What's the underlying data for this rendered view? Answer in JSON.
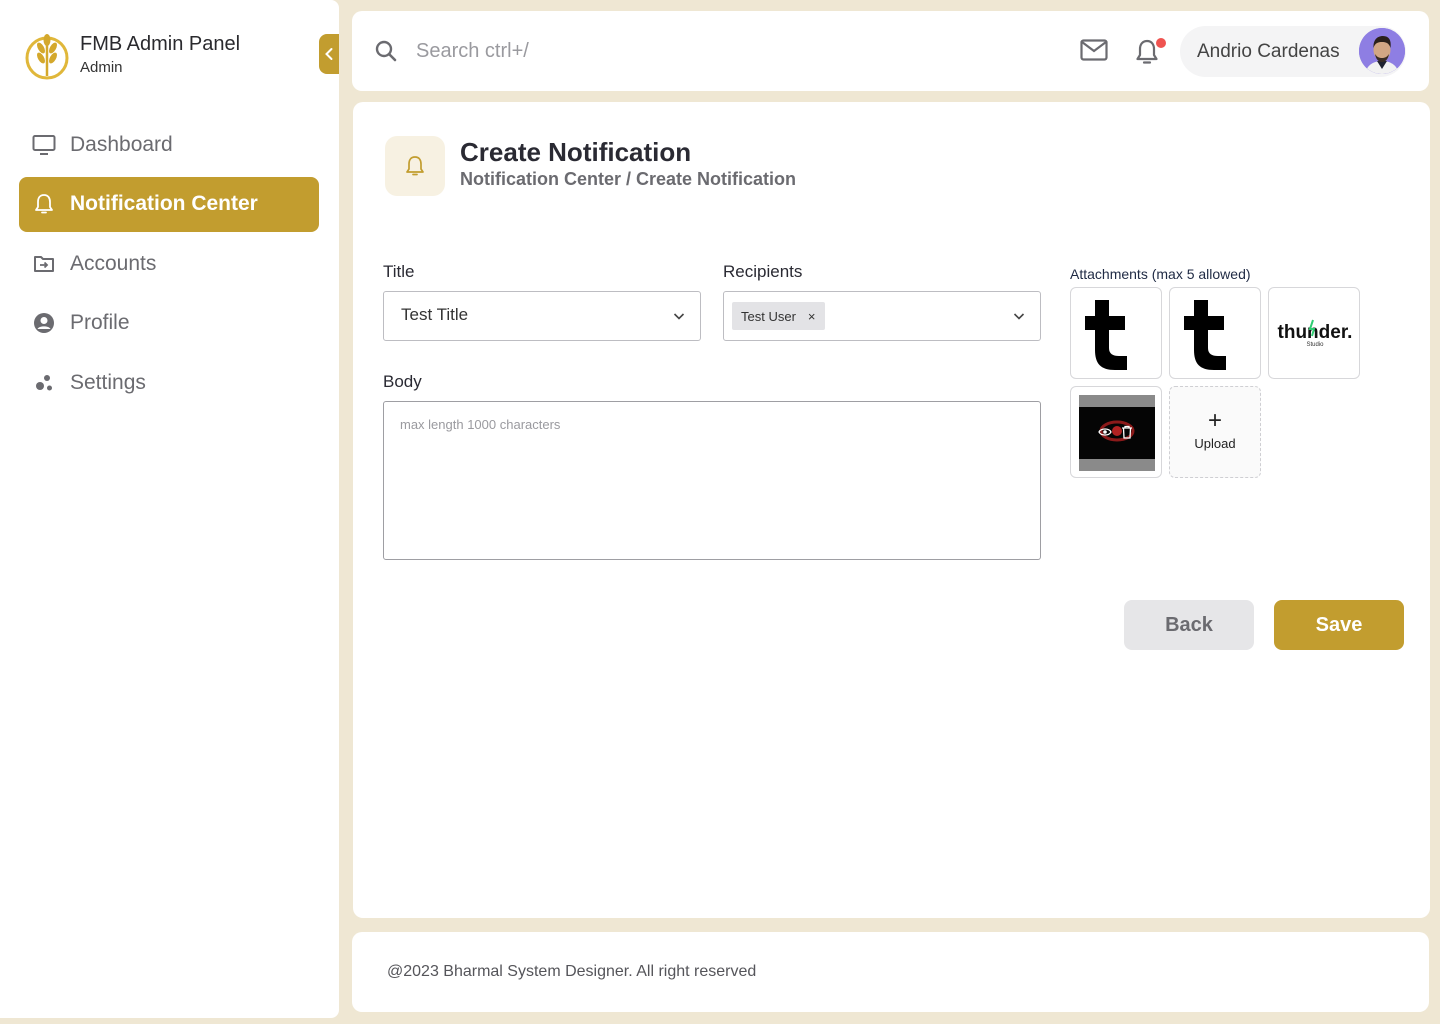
{
  "app": {
    "title": "FMB Admin Panel",
    "role": "Admin",
    "accent_color": "#c29d2f"
  },
  "sidebar": {
    "items": [
      {
        "label": "Dashboard",
        "icon": "monitor-icon",
        "active": false
      },
      {
        "label": "Notification Center",
        "icon": "bell-icon",
        "active": true
      },
      {
        "label": "Accounts",
        "icon": "folder-icon",
        "active": false
      },
      {
        "label": "Profile",
        "icon": "user-circle-icon",
        "active": false
      },
      {
        "label": "Settings",
        "icon": "dots-icon",
        "active": false
      }
    ]
  },
  "topbar": {
    "search_placeholder": "Search ctrl+/",
    "user_name": "Andrio Cardenas",
    "has_unread_notifications": true
  },
  "page": {
    "title": "Create Notification",
    "breadcrumb": "Notification Center / Create Notification"
  },
  "form": {
    "title_label": "Title",
    "title_value": "Test Title",
    "recipients_label": "Recipients",
    "recipients": [
      "Test User"
    ],
    "tag_remove_glyph": "×",
    "body_label": "Body",
    "body_placeholder": "max length 1000 characters",
    "attachments_label": "Attachments (max 5 allowed)",
    "attachments": [
      {
        "name": "tumblr-t-logo"
      },
      {
        "name": "tumblr-t-logo"
      },
      {
        "name": "thunder-studio-logo",
        "text": "thunder.",
        "subtext": "Studio"
      },
      {
        "name": "dark-image"
      }
    ],
    "upload_glyph": "+",
    "upload_label": "Upload",
    "back_label": "Back",
    "save_label": "Save"
  },
  "footer": {
    "text": "@2023 Bharmal System Designer. All right reserved"
  }
}
